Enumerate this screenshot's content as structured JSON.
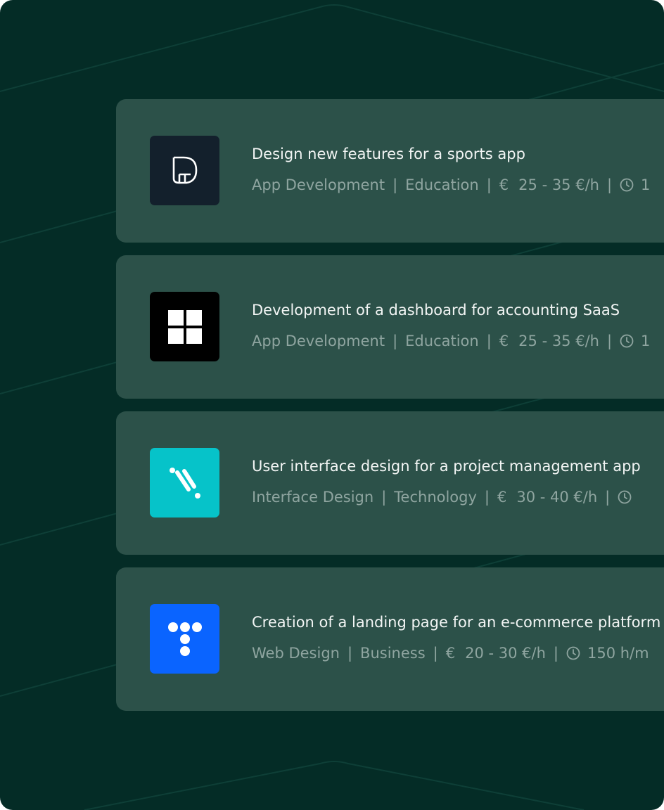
{
  "colors": {
    "background": "#042c26",
    "card": "#2c5149",
    "title_text": "#f2f5f4",
    "meta_text": "#8fa5a0"
  },
  "jobs": [
    {
      "title": "Design new features for a sports app",
      "category": "App Development",
      "industry": "Education",
      "currency": "€",
      "rate": "25 - 35 €/h",
      "hours": "1",
      "logo_icon": "d-letter-logo-icon",
      "logo_color": "#13202c"
    },
    {
      "title": "Development of a dashboard for accounting SaaS",
      "category": "App Development",
      "industry": "Education",
      "currency": "€",
      "rate": "25 - 35 €/h",
      "hours": "1",
      "logo_icon": "windows-grid-logo-icon",
      "logo_color": "#000000"
    },
    {
      "title": "User interface design for a project management app",
      "category": "Interface Design",
      "industry": "Technology",
      "currency": "€",
      "rate": "30 - 40 €/h",
      "hours": "",
      "logo_icon": "percent-slash-logo-icon",
      "logo_color": "#06c3c9"
    },
    {
      "title": "Creation of a landing page for an e-commerce platform",
      "category": "Web Design",
      "industry": "Business",
      "currency": "€",
      "rate": "20 - 30 €/h",
      "hours": "150 h/m",
      "logo_icon": "dots-t-logo-icon",
      "logo_color": "#0a64ff"
    }
  ]
}
